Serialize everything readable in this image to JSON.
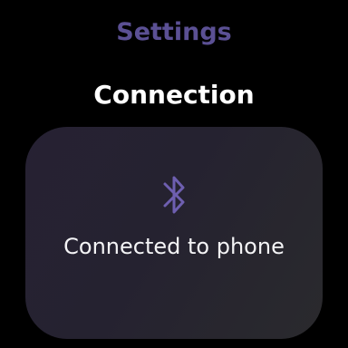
{
  "header": {
    "title": "Settings"
  },
  "section": {
    "title": "Connection"
  },
  "card": {
    "icon": "bluetooth-icon",
    "status_text": "Connected to phone"
  },
  "colors": {
    "background": "#000000",
    "accent": "#5b5094",
    "card_background": "#262133",
    "text_primary": "#ffffff"
  }
}
